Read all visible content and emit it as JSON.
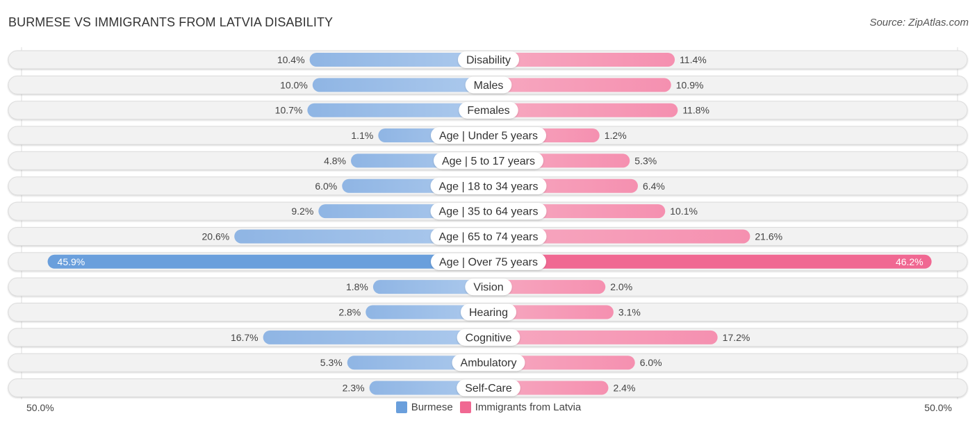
{
  "header": {
    "title": "BURMESE VS IMMIGRANTS FROM LATVIA DISABILITY",
    "source": "Source: ZipAtlas.com"
  },
  "axis": {
    "left_label": "50.0%",
    "right_label": "50.0%"
  },
  "legend": [
    {
      "name": "Burmese",
      "color": "#6a9fdc"
    },
    {
      "name": "Immigrants from Latvia",
      "color": "#f06892"
    }
  ],
  "chart_data": {
    "type": "bar",
    "orientation": "horizontal-diverging",
    "title": "BURMESE VS IMMIGRANTS FROM LATVIA DISABILITY",
    "xlim": [
      -50,
      50
    ],
    "xlabel": "",
    "ylabel": "",
    "legend_position": "bottom",
    "categories": [
      "Disability",
      "Males",
      "Females",
      "Age | Under 5 years",
      "Age | 5 to 17 years",
      "Age | 18 to 34 years",
      "Age | 35 to 64 years",
      "Age | 65 to 74 years",
      "Age | Over 75 years",
      "Vision",
      "Hearing",
      "Cognitive",
      "Ambulatory",
      "Self-Care"
    ],
    "series": [
      {
        "name": "Burmese",
        "color": "#6a9fdc",
        "side": "left",
        "values": [
          10.4,
          10.0,
          10.7,
          1.1,
          4.8,
          6.0,
          9.2,
          20.6,
          45.9,
          1.8,
          2.8,
          16.7,
          5.3,
          2.3
        ],
        "labels": [
          "10.4%",
          "10.0%",
          "10.7%",
          "1.1%",
          "4.8%",
          "6.0%",
          "9.2%",
          "20.6%",
          "45.9%",
          "1.8%",
          "2.8%",
          "16.7%",
          "5.3%",
          "2.3%"
        ]
      },
      {
        "name": "Immigrants from Latvia",
        "color": "#f06892",
        "side": "right",
        "values": [
          11.4,
          10.9,
          11.8,
          1.2,
          5.3,
          6.4,
          10.1,
          21.6,
          46.2,
          2.0,
          3.1,
          17.2,
          6.0,
          2.4
        ],
        "labels": [
          "11.4%",
          "10.9%",
          "11.8%",
          "1.2%",
          "5.3%",
          "6.4%",
          "10.1%",
          "21.6%",
          "46.2%",
          "2.0%",
          "3.1%",
          "17.2%",
          "6.0%",
          "2.4%"
        ]
      }
    ]
  }
}
